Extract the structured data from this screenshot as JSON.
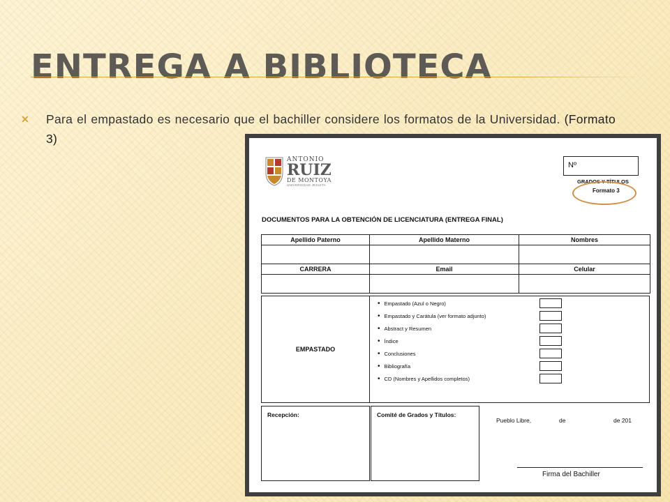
{
  "slide": {
    "title": "Entrega a biblioteca",
    "bullet_text": "Para el empastado es necesario que el bachiller considere los formatos de la Universidad.",
    "bullet_emphasis": "(Formato 3)",
    "accent_color": "#d8a946"
  },
  "document": {
    "logo": {
      "line1": "ANTONIO",
      "line2": "RUIZ",
      "line3": "DE MONTOYA",
      "line4": "UNIVERSIDAD JESUITA"
    },
    "number_label": "Nº",
    "office_label": "GRADOS Y TÍTULOS",
    "format_label": "Formato 3",
    "heading": "DOCUMENTOS PARA LA OBTENCIÓN DE LICENCIATURA (ENTREGA FINAL)",
    "row1_headers": [
      "Apellido Paterno",
      "Apellido Materno",
      "Nombres"
    ],
    "row2_headers": [
      "CARRERA",
      "Email",
      "Celular"
    ],
    "empastado_label": "EMPASTADO",
    "checklist": [
      "Empastado (Azul o Negro)",
      "Empastado y Carátula (ver formato adjunto)",
      "Abstract y Resumen",
      "Índice",
      "Conclusiones",
      "Bibliografía",
      "CD (Nombres y Apellidos completos)"
    ],
    "recepcion_label": "Recepción:",
    "comite_label": "Comité de Grados y Títulos:",
    "place_label": "Pueblo Libre,",
    "de1": "de",
    "de2": "de 201",
    "signature_label": "Firma del Bachiller"
  }
}
